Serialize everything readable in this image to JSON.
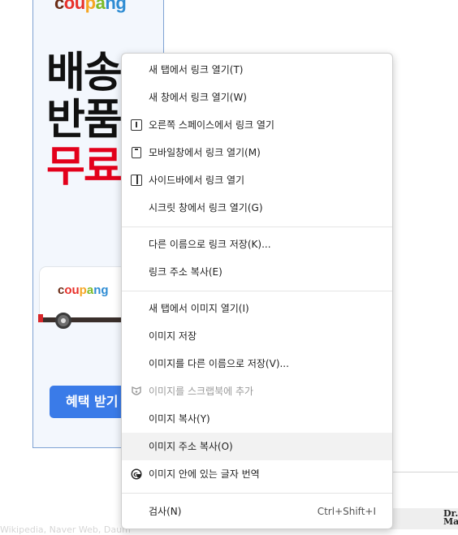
{
  "ad": {
    "brand_top": "coupang",
    "headline": [
      "배송!",
      "반품!",
      "무료!"
    ],
    "truck_brand": "coupang",
    "cta_label": "혜택 받기",
    "brand_colors": [
      "#6b2d17",
      "#e8312b",
      "#f5a623",
      "#7cbb2a",
      "#2e8cd3"
    ]
  },
  "background": {
    "side_thumb_text": "Dr. Ma",
    "bottom_text": "Wikipedia, Naver Web, Daum"
  },
  "context_menu": {
    "items": [
      {
        "label": "새 탭에서 링크 열기(T)",
        "icon": null
      },
      {
        "label": "새 창에서 링크 열기(W)",
        "icon": null
      },
      {
        "label": "오른쪽 스페이스에서 링크 열기",
        "icon": "split-pane-icon"
      },
      {
        "label": "모바일창에서 링크 열기(M)",
        "icon": "mobile-icon"
      },
      {
        "label": "사이드바에서 링크 열기",
        "icon": "sidebar-icon"
      },
      {
        "label": "시크릿 창에서 링크 열기(G)",
        "icon": null
      },
      {
        "label": "다른 이름으로 링크 저장(K)...",
        "icon": null
      },
      {
        "label": "링크 주소 복사(E)",
        "icon": null
      },
      {
        "label": "새 탭에서 이미지 열기(I)",
        "icon": null
      },
      {
        "label": "이미지 저장",
        "icon": null
      },
      {
        "label": "이미지를 다른 이름으로 저장(V)...",
        "icon": null
      },
      {
        "label": "이미지를 스크랩북에 추가",
        "icon": "scrapbook-icon",
        "disabled": true
      },
      {
        "label": "이미지 복사(Y)",
        "icon": null
      },
      {
        "label": "이미지 주소 복사(O)",
        "icon": null,
        "highlighted": true
      },
      {
        "label": "이미지 안에 있는 글자 번역",
        "icon": "translate-icon"
      },
      {
        "label": "검사(N)",
        "icon": null,
        "shortcut": "Ctrl+Shift+I"
      }
    ]
  }
}
